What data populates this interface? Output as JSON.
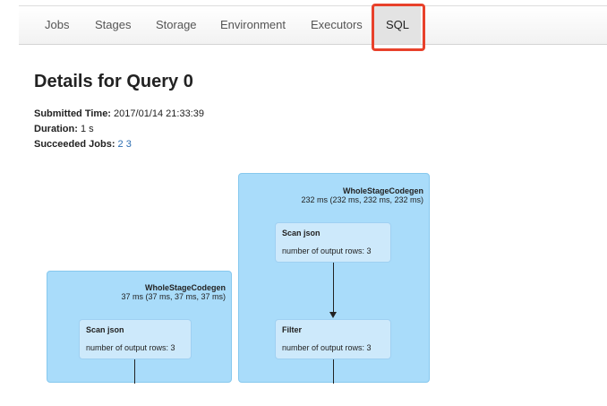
{
  "nav": {
    "items": [
      {
        "label": "Jobs"
      },
      {
        "label": "Stages"
      },
      {
        "label": "Storage"
      },
      {
        "label": "Environment"
      },
      {
        "label": "Executors"
      },
      {
        "label": "SQL",
        "active": true
      }
    ]
  },
  "page": {
    "title": "Details for Query 0"
  },
  "details": {
    "submitted_label": "Submitted Time:",
    "submitted_value": "2017/01/14 21:33:39",
    "duration_label": "Duration:",
    "duration_value": "1 s",
    "jobs_label": "Succeeded Jobs:",
    "jobs": [
      "2",
      "3"
    ]
  },
  "dag": {
    "clusters": [
      {
        "name": "WholeStageCodegen",
        "metrics": "37 ms (37 ms, 37 ms, 37 ms)",
        "nodes": [
          {
            "name": "Scan json",
            "metric": "number of output rows: 3"
          }
        ]
      },
      {
        "name": "WholeStageCodegen",
        "metrics": "232 ms (232 ms, 232 ms, 232 ms)",
        "nodes": [
          {
            "name": "Scan json",
            "metric": "number of output rows: 3"
          },
          {
            "name": "Filter",
            "metric": "number of output rows: 3"
          }
        ]
      }
    ]
  }
}
